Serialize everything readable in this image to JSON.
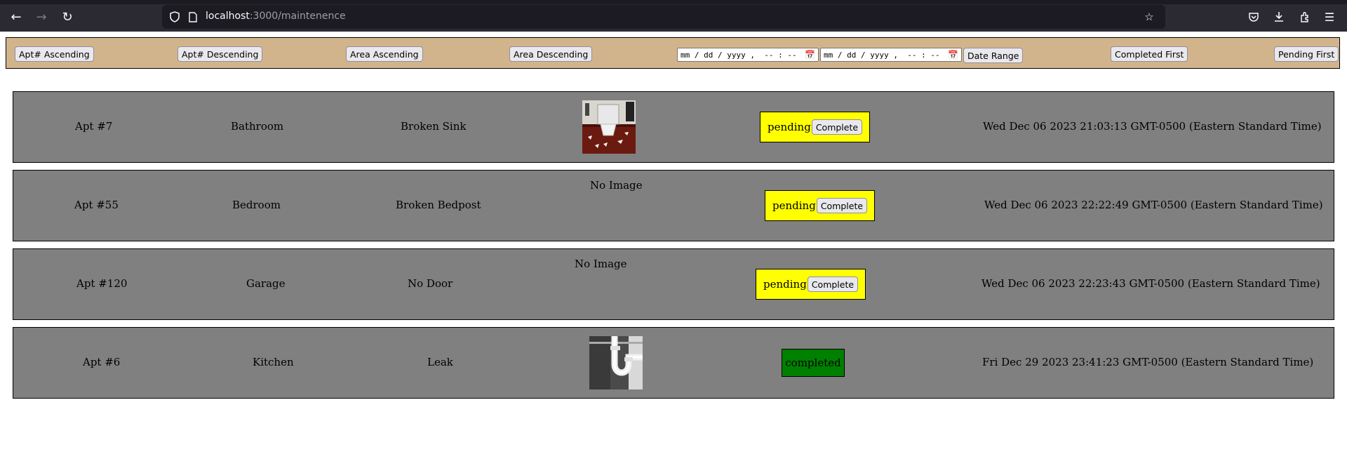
{
  "browser": {
    "url_host": "localhost",
    "url_path": ":3000/maintenence"
  },
  "toolbar": {
    "apt_asc": "Apt# Ascending",
    "apt_desc": "Apt# Descending",
    "area_asc": "Area Ascending",
    "area_desc": "Area Descending",
    "date_from_placeholder": "mm / dd / yyyy ,  -- : --  --",
    "date_to_placeholder": "mm / dd / yyyy ,  -- : --  --",
    "date_range": "Date Range",
    "completed_first": "Completed First",
    "pending_first": "Pending First"
  },
  "requests": [
    {
      "apt": "Apt #7",
      "area": "Bathroom",
      "issue": "Broken Sink",
      "image": "broken-sink-photo",
      "status": "pending",
      "complete_label": "Complete",
      "date": "Wed Dec 06 2023 21:03:13 GMT-0500 (Eastern Standard Time)"
    },
    {
      "apt": "Apt #55",
      "area": "Bedroom",
      "issue": "Broken Bedpost",
      "image_text": "No Image",
      "status": "pending",
      "complete_label": "Complete",
      "date": "Wed Dec 06 2023 22:22:49 GMT-0500 (Eastern Standard Time)"
    },
    {
      "apt": "Apt #120",
      "area": "Garage",
      "issue": "No Door",
      "image_text": "No Image",
      "status": "pending",
      "complete_label": "Complete",
      "date": "Wed Dec 06 2023 22:23:43 GMT-0500 (Eastern Standard Time)"
    },
    {
      "apt": "Apt #6",
      "area": "Kitchen",
      "issue": "Leak",
      "image": "leaky-pipe-photo",
      "status": "completed",
      "date": "Fri Dec 29 2023 23:41:23 GMT-0500 (Eastern Standard Time)"
    }
  ],
  "colors": {
    "toolbar_bg": "#d2b48c",
    "row_bg": "#808080",
    "pending_bg": "#ffff00",
    "completed_bg": "#008000"
  }
}
